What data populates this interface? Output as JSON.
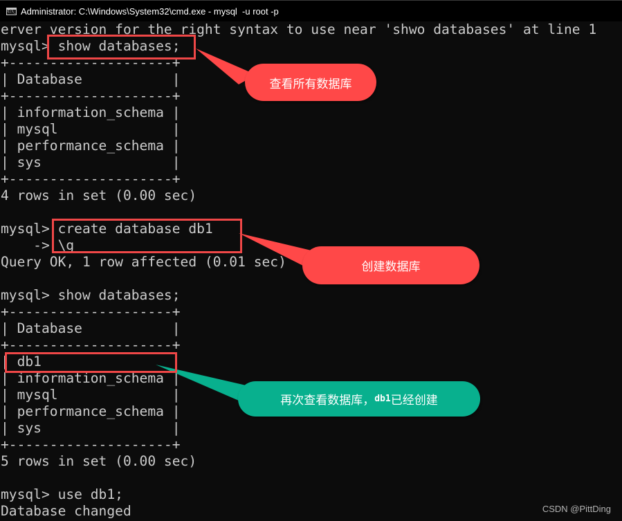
{
  "window": {
    "icon": "cmd-icon",
    "icon_text": "C:\\_",
    "title": "Administrator: C:\\Windows\\System32\\cmd.exe - mysql  -u root -p"
  },
  "console": {
    "lines": [
      "erver version for the right syntax to use near 'shwo databases' at line 1",
      "mysql> show databases;",
      "+--------------------+",
      "| Database           |",
      "+--------------------+",
      "| information_schema |",
      "| mysql              |",
      "| performance_schema |",
      "| sys                |",
      "+--------------------+",
      "4 rows in set (0.00 sec)",
      "",
      "mysql> create database db1",
      "    -> \\g",
      "Query OK, 1 row affected (0.01 sec)",
      "",
      "mysql> show databases;",
      "+--------------------+",
      "| Database           |",
      "+--------------------+",
      "| db1                |",
      "| information_schema |",
      "| mysql              |",
      "| performance_schema |",
      "| sys                |",
      "+--------------------+",
      "5 rows in set (0.00 sec)",
      "",
      "mysql> use db1;",
      "Database changed"
    ]
  },
  "annotations": {
    "callout1": {
      "text": "查看所有数据库",
      "color": "#ff4848"
    },
    "callout2": {
      "text": "创建数据库",
      "color": "#ff4848"
    },
    "callout3": {
      "text_before": "再次查看数据库，",
      "text_code": "db1",
      "text_after": "已经创建",
      "color": "#08b08e"
    },
    "box_color": "#ef4747"
  },
  "watermark": "CSDN @PittDing"
}
